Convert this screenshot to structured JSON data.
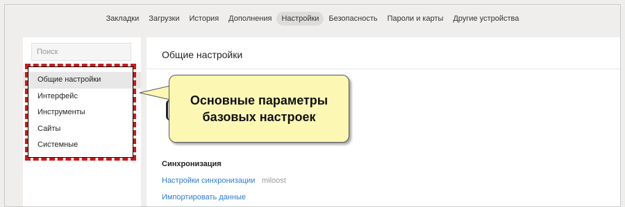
{
  "topnav": {
    "tabs": [
      {
        "label": "Закладки"
      },
      {
        "label": "Загрузки"
      },
      {
        "label": "История"
      },
      {
        "label": "Дополнения"
      },
      {
        "label": "Настройки",
        "active": true
      },
      {
        "label": "Безопасность"
      },
      {
        "label": "Пароли и карты"
      },
      {
        "label": "Другие устройства"
      }
    ]
  },
  "sidebar": {
    "search_placeholder": "Поиск",
    "items": [
      {
        "label": "Общие настройки",
        "active": true
      },
      {
        "label": "Интерфейс"
      },
      {
        "label": "Инструменты"
      },
      {
        "label": "Сайты"
      },
      {
        "label": "Системные"
      }
    ]
  },
  "main": {
    "title": "Общие настройки",
    "sync_section": {
      "title": "Синхронизация",
      "sync_link": "Настройки синхронизации",
      "user": "miloost",
      "import_link": "Импортировать данные"
    }
  },
  "callout": {
    "line1": "Основные параметры",
    "line2": "базовых настроек"
  },
  "colors": {
    "highlight": "#d01818",
    "callout_bg": "#fdf7b4",
    "link": "#2a7bd5",
    "active_tab_bg": "#dedcda"
  }
}
